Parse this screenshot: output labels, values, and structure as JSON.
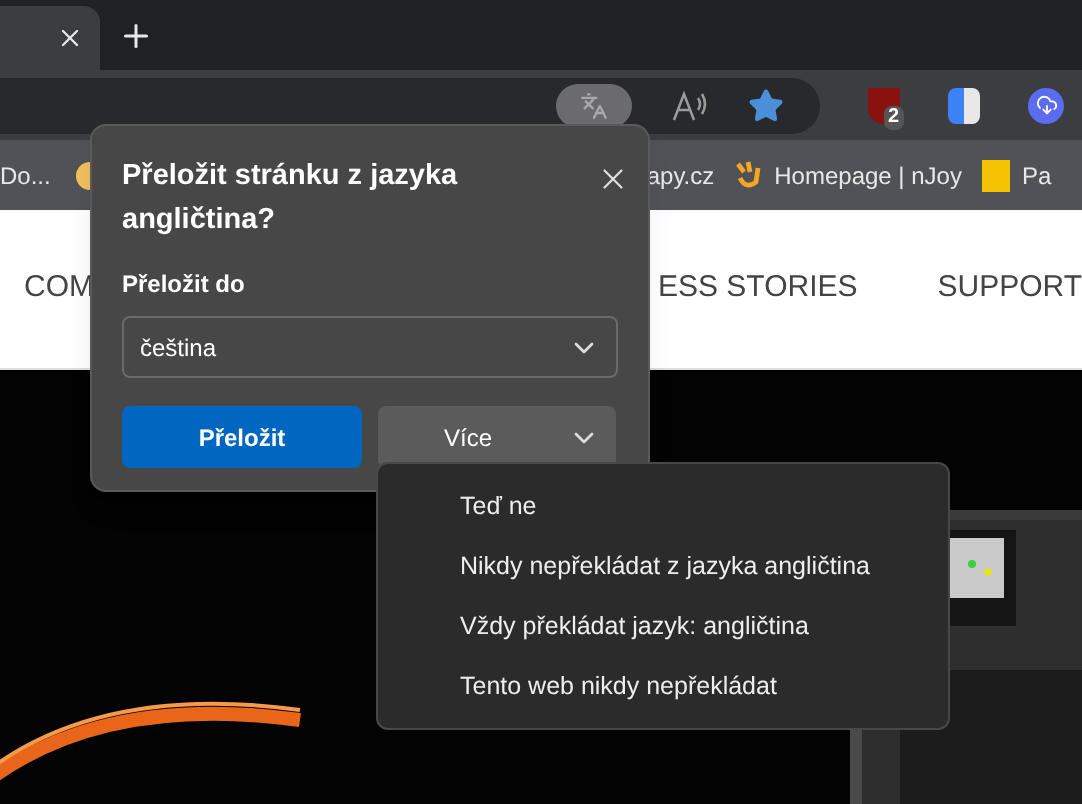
{
  "toolbar": {
    "extension_badge": "2"
  },
  "bookmarks": [
    {
      "label": "Do...",
      "kind": "text"
    },
    {
      "label": "apy.cz",
      "kind": "text"
    },
    {
      "label": "Homepage | nJoy",
      "kind": "hand"
    },
    {
      "label": "Pa",
      "kind": "rj"
    }
  ],
  "site_nav": [
    "COM",
    "ESS STORIES",
    "SUPPORT"
  ],
  "translate_popup": {
    "title": "Přeložit stránku z jazyka angličtina?",
    "target_label": "Přeložit do",
    "target_value": "čeština",
    "primary_button": "Přeložit",
    "more_button": "Více"
  },
  "more_menu": [
    "Teď ne",
    "Nikdy nepřekládat z jazyka angličtina",
    "Vždy překládat jazyk: angličtina",
    "Tento web nikdy nepřekládat"
  ]
}
